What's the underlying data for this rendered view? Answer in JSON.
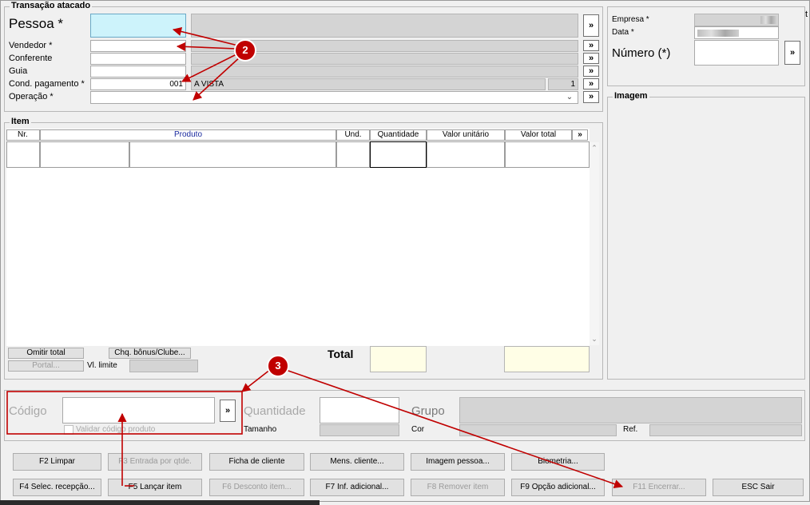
{
  "header_group": {
    "title": "Transação atacado",
    "pessoa": {
      "label": "Pessoa *"
    },
    "vendedor": {
      "label": "Vendedor *"
    },
    "conferente": {
      "label": "Conferente"
    },
    "guia": {
      "label": "Guia"
    },
    "cond_pagamento": {
      "label": "Cond. pagamento *",
      "code": "001",
      "desc": "A VISTA",
      "parcelas": "1"
    },
    "operacao": {
      "label": "Operação *"
    },
    "more_button": "»"
  },
  "empresa_group": {
    "empresa_label": "Empresa *",
    "data_label": "Data *",
    "numero_label": "Número (*)",
    "more_button": "»"
  },
  "imagem_group": {
    "title": "Imagem"
  },
  "item_group": {
    "title": "Item",
    "columns": [
      "Nr.",
      "Produto",
      "Und.",
      "Quantidade",
      "Valor unitário",
      "Valor total",
      "»"
    ],
    "omitir_total": "Omitir total",
    "portal": "Portal...",
    "chq_bonus": "Chq. bônus/Clube...",
    "vl_limite": "Vl. limite",
    "total_label": "Total"
  },
  "produto_group": {
    "codigo_label": "Código",
    "validar_label": "Validar código produto",
    "quantidade_label": "Quantidade",
    "tamanho_label": "Tamanho",
    "grupo_label": "Grupo",
    "cor_label": "Cor",
    "ref_label": "Ref.",
    "more_button": "»"
  },
  "buttons_row1": [
    "F2 Limpar",
    "F3 Entrada por qtde.",
    "Ficha de cliente",
    "Mens. cliente...",
    "Imagem pessoa...",
    "Biometria..."
  ],
  "buttons_row2": [
    "F4 Selec. recepção...",
    "F5 Lançar item",
    "F6 Desconto item...",
    "F7 Inf. adicional...",
    "F8 Remover item",
    "F9 Opção adicional...",
    "F11 Encerrar...",
    "ESC Sair"
  ],
  "annotations": {
    "callout_2": "2",
    "callout_3": "3"
  },
  "colors": {
    "highlight_field": "#cdf3fb",
    "total_field": "#fffee6",
    "annotation": "#c00000"
  }
}
